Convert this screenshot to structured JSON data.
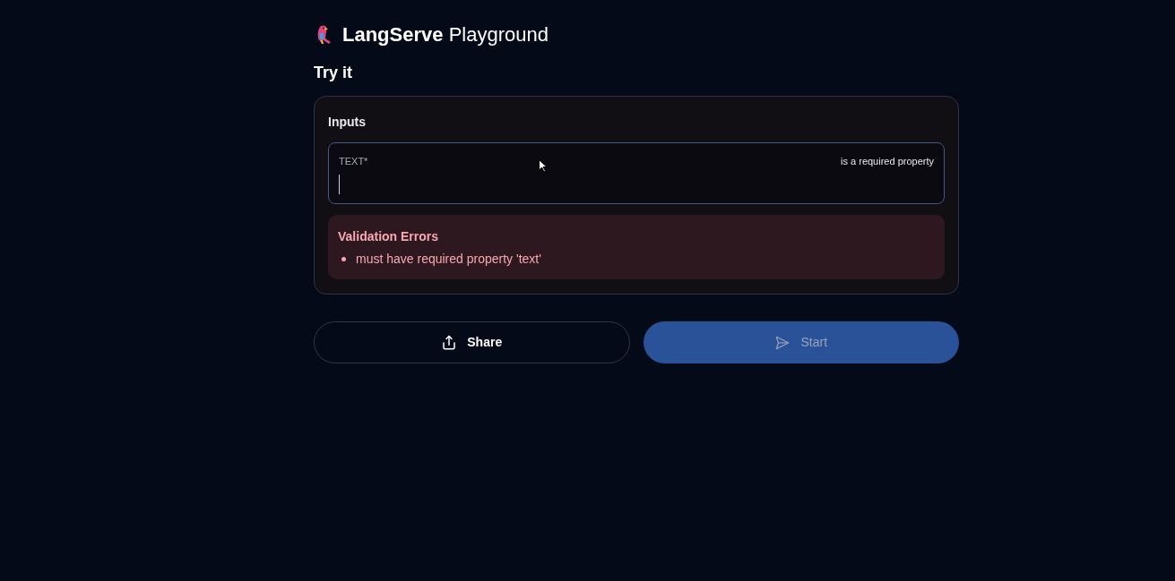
{
  "header": {
    "brand": "LangServe",
    "title": "Playground"
  },
  "section_title": "Try it",
  "inputs": {
    "heading": "Inputs",
    "fields": [
      {
        "label": "TEXT*",
        "hint": "is a required property",
        "focused": true
      }
    ],
    "errors": {
      "title": "Validation Errors",
      "items": [
        "must have required property 'text'"
      ]
    }
  },
  "buttons": [
    {
      "kind": "share",
      "label": "Share",
      "disabled": false
    },
    {
      "kind": "start",
      "label": "Start",
      "disabled": true
    }
  ]
}
